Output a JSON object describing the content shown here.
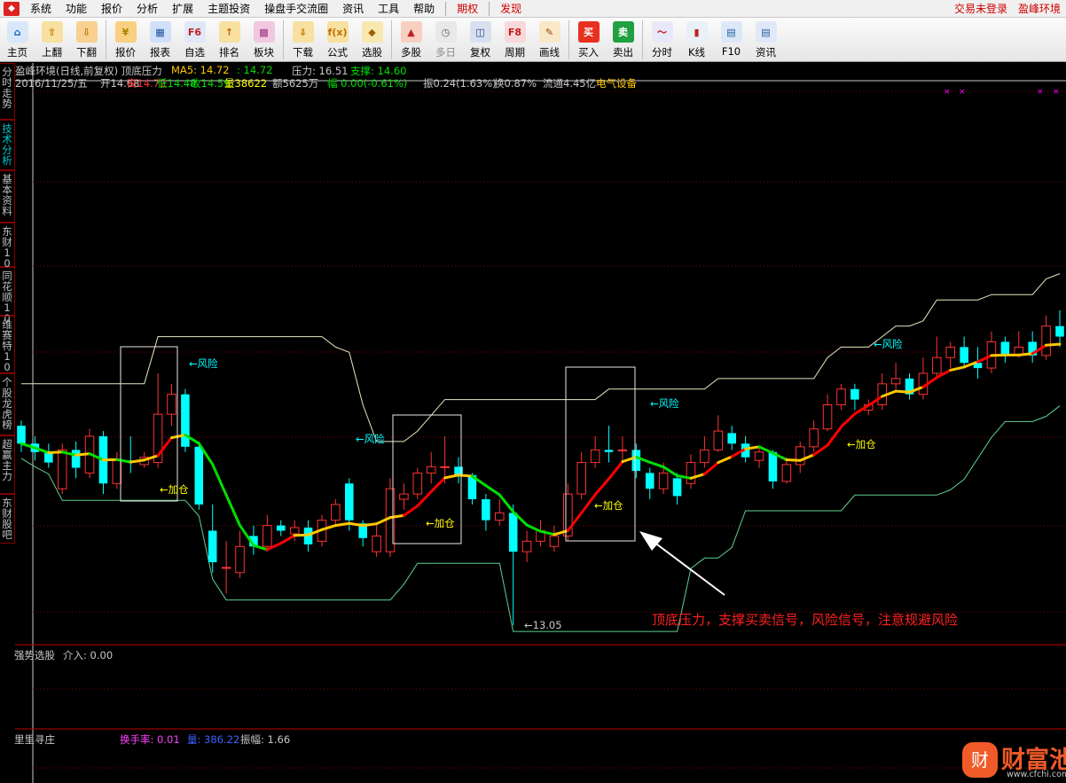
{
  "menubar": {
    "items": [
      "系统",
      "功能",
      "报价",
      "分析",
      "扩展",
      "主题投资",
      "操盘手交流圈",
      "资讯",
      "工具",
      "帮助"
    ],
    "highlight_items": [
      "期权",
      "发现"
    ],
    "login_status": "交易未登录",
    "stock_name": "盈峰环境"
  },
  "toolbar": {
    "buttons": [
      {
        "label": "主页",
        "icon": "home-icon"
      },
      {
        "label": "上翻",
        "icon": "arrow-up-icon"
      },
      {
        "label": "下翻",
        "icon": "arrow-down-icon"
      },
      {
        "label": "报价",
        "icon": "quote-icon"
      },
      {
        "label": "报表",
        "icon": "report-icon"
      },
      {
        "label": "自选",
        "icon": "f6-icon",
        "glyph": "F6"
      },
      {
        "label": "排名",
        "icon": "rank-icon"
      },
      {
        "label": "板块",
        "icon": "sector-icon"
      },
      {
        "label": "下载",
        "icon": "download-icon"
      },
      {
        "label": "公式",
        "icon": "formula-icon",
        "glyph": "f(x)"
      },
      {
        "label": "选股",
        "icon": "stock-pick-icon"
      },
      {
        "label": "多股",
        "icon": "multi-stock-icon"
      },
      {
        "label": "多日",
        "icon": "multi-day-icon",
        "dim": true
      },
      {
        "label": "复权",
        "icon": "adjust-icon"
      },
      {
        "label": "周期",
        "icon": "f8-icon",
        "glyph": "F8"
      },
      {
        "label": "画线",
        "icon": "draw-line-icon"
      },
      {
        "label": "买入",
        "icon": "buy-icon",
        "glyph": "买"
      },
      {
        "label": "卖出",
        "icon": "sell-icon",
        "glyph": "卖"
      },
      {
        "label": "分时",
        "icon": "intraday-icon"
      },
      {
        "label": "K线",
        "icon": "kline-icon"
      },
      {
        "label": "F10",
        "icon": "f10-icon"
      },
      {
        "label": "资讯",
        "icon": "news-icon"
      }
    ]
  },
  "sidetabs": [
    {
      "label": "分时走势",
      "active": false
    },
    {
      "label": "技术分析",
      "active": true
    },
    {
      "label": "基本资料",
      "active": false
    },
    {
      "label": "东财10",
      "active": false
    },
    {
      "label": "同花顺10",
      "active": false
    },
    {
      "label": "维赛特10",
      "active": false
    },
    {
      "label": "个股龙虎榜",
      "active": false
    },
    {
      "label": "超赢主力",
      "active": false
    },
    {
      "label": "东财股吧",
      "active": false
    }
  ],
  "main_header": {
    "title": "盈峰环境(日线,前复权) 顶底压力",
    "ma5_label": "MA5: 14.72",
    "ma5_value": ": 14.72",
    "pressure": "压力: 16.51",
    "support": "支撑: 14.60",
    "date": "2016/11/25/五",
    "open": "开14.68",
    "high": "高14.72",
    "low": "低14.48",
    "close": "收14.59",
    "volume": "量38622",
    "amount": "额5625万",
    "change": "幅 0.00(-0.61%)",
    "amplitude": "振0.24(1.63%)",
    "turnover": "换0.87%",
    "float_cap": "流通4.45亿",
    "industry": "电气设备"
  },
  "annotations": {
    "risk": "←风险",
    "add": "←加仓",
    "low_marker": "←13.05",
    "note": "顶底压力，支撑买卖信号，风险信号，注意规避风险"
  },
  "sub1": {
    "title": "强势选股",
    "value": "介入: 0.00"
  },
  "sub2": {
    "title": "里里寻庄",
    "turnover": "换手率: 0.01",
    "volume": "量: 386.22",
    "amplitude": "振幅: 1.66"
  },
  "watermark": {
    "brand": "财富池",
    "url": "www.cfchi.com",
    "badge_glyph": "财"
  },
  "colors": {
    "up": "#ff3232",
    "down": "#00ffff",
    "ma_up": "#ff0000",
    "ma_down": "#00e000",
    "ma_flat": "#ffc800",
    "grid": "#800000",
    "cyan_text": "#00ffff",
    "yellow_text": "#ffff00",
    "pressure_line": "#e8e8c0",
    "support_line": "#60d090"
  },
  "chart_data": {
    "type": "candlestick",
    "ma_label": "MA5",
    "low_point": 13.05,
    "candles": [
      {
        "o": 14.95,
        "c": 14.78,
        "h": 15.0,
        "l": 14.7
      },
      {
        "o": 14.78,
        "c": 14.7,
        "h": 14.85,
        "l": 14.62
      },
      {
        "o": 14.7,
        "c": 14.6,
        "h": 14.78,
        "l": 14.55
      },
      {
        "o": 14.35,
        "c": 14.72,
        "h": 14.78,
        "l": 14.3
      },
      {
        "o": 14.72,
        "c": 14.55,
        "h": 14.8,
        "l": 14.45
      },
      {
        "o": 14.5,
        "c": 14.85,
        "h": 14.92,
        "l": 14.45
      },
      {
        "o": 14.85,
        "c": 14.4,
        "h": 14.9,
        "l": 14.3
      },
      {
        "o": 14.4,
        "c": 14.62,
        "h": 14.7,
        "l": 14.35
      },
      {
        "o": 14.62,
        "c": 14.6,
        "h": 14.85,
        "l": 14.5
      },
      {
        "o": 14.58,
        "c": 14.65,
        "h": 14.7,
        "l": 14.55
      },
      {
        "o": 14.6,
        "c": 15.06,
        "h": 15.45,
        "l": 14.55
      },
      {
        "o": 15.06,
        "c": 15.25,
        "h": 15.35,
        "l": 14.95
      },
      {
        "o": 15.25,
        "c": 14.75,
        "h": 15.3,
        "l": 14.7
      },
      {
        "o": 14.75,
        "c": 14.2,
        "h": 14.8,
        "l": 14.15
      },
      {
        "o": 13.95,
        "c": 13.65,
        "h": 14.2,
        "l": 13.55
      },
      {
        "o": 13.6,
        "c": 13.6,
        "h": 13.85,
        "l": 13.35
      },
      {
        "o": 13.55,
        "c": 13.8,
        "h": 13.95,
        "l": 13.5
      },
      {
        "o": 13.9,
        "c": 13.8,
        "h": 14.0,
        "l": 13.72
      },
      {
        "o": 13.8,
        "c": 14.0,
        "h": 14.1,
        "l": 13.75
      },
      {
        "o": 14.0,
        "c": 13.95,
        "h": 14.05,
        "l": 13.9
      },
      {
        "o": 13.92,
        "c": 13.98,
        "h": 14.05,
        "l": 13.85
      },
      {
        "o": 13.98,
        "c": 13.82,
        "h": 14.05,
        "l": 13.75
      },
      {
        "o": 13.85,
        "c": 14.05,
        "h": 14.1,
        "l": 13.8
      },
      {
        "o": 14.05,
        "c": 14.2,
        "h": 14.25,
        "l": 14.0
      },
      {
        "o": 14.4,
        "c": 14.05,
        "h": 14.45,
        "l": 13.95
      },
      {
        "o": 14.02,
        "c": 13.88,
        "h": 14.05,
        "l": 13.8
      },
      {
        "o": 13.75,
        "c": 13.9,
        "h": 14.0,
        "l": 13.7
      },
      {
        "o": 13.75,
        "c": 14.35,
        "h": 14.45,
        "l": 13.7
      },
      {
        "o": 14.25,
        "c": 14.3,
        "h": 14.4,
        "l": 14.15
      },
      {
        "o": 14.3,
        "c": 14.5,
        "h": 14.55,
        "l": 14.25
      },
      {
        "o": 14.5,
        "c": 14.56,
        "h": 14.7,
        "l": 14.4
      },
      {
        "o": 14.56,
        "c": 14.56,
        "h": 14.85,
        "l": 14.4
      },
      {
        "o": 14.56,
        "c": 14.48,
        "h": 14.65,
        "l": 14.4
      },
      {
        "o": 14.48,
        "c": 14.25,
        "h": 14.5,
        "l": 14.2
      },
      {
        "o": 14.25,
        "c": 14.05,
        "h": 14.3,
        "l": 13.95
      },
      {
        "o": 14.05,
        "c": 14.12,
        "h": 14.25,
        "l": 14.0
      },
      {
        "o": 14.12,
        "c": 13.75,
        "h": 14.2,
        "l": 13.05
      },
      {
        "o": 13.75,
        "c": 13.85,
        "h": 13.95,
        "l": 13.65
      },
      {
        "o": 13.85,
        "c": 13.95,
        "h": 14.05,
        "l": 13.8
      },
      {
        "o": 13.8,
        "c": 13.9,
        "h": 14.0,
        "l": 13.75
      },
      {
        "o": 13.9,
        "c": 14.3,
        "h": 14.4,
        "l": 13.85
      },
      {
        "o": 14.3,
        "c": 14.6,
        "h": 14.7,
        "l": 14.25
      },
      {
        "o": 14.6,
        "c": 14.72,
        "h": 14.85,
        "l": 14.55
      },
      {
        "o": 14.72,
        "c": 14.7,
        "h": 14.95,
        "l": 14.6
      },
      {
        "o": 14.72,
        "c": 14.72,
        "h": 14.85,
        "l": 14.6
      },
      {
        "o": 14.72,
        "c": 14.52,
        "h": 14.78,
        "l": 14.45
      },
      {
        "o": 14.5,
        "c": 14.35,
        "h": 14.55,
        "l": 14.25
      },
      {
        "o": 14.35,
        "c": 14.5,
        "h": 14.6,
        "l": 14.3
      },
      {
        "o": 14.45,
        "c": 14.28,
        "h": 14.5,
        "l": 14.2
      },
      {
        "o": 14.4,
        "c": 14.6,
        "h": 14.68,
        "l": 14.35
      },
      {
        "o": 14.6,
        "c": 14.72,
        "h": 14.85,
        "l": 14.55
      },
      {
        "o": 14.72,
        "c": 14.9,
        "h": 15.05,
        "l": 14.7
      },
      {
        "o": 14.88,
        "c": 14.78,
        "h": 14.95,
        "l": 14.72
      },
      {
        "o": 14.78,
        "c": 14.65,
        "h": 14.85,
        "l": 14.6
      },
      {
        "o": 14.62,
        "c": 14.7,
        "h": 14.75,
        "l": 14.55
      },
      {
        "o": 14.7,
        "c": 14.42,
        "h": 14.72,
        "l": 14.35
      },
      {
        "o": 14.42,
        "c": 14.58,
        "h": 14.65,
        "l": 14.4
      },
      {
        "o": 14.58,
        "c": 14.75,
        "h": 14.8,
        "l": 14.5
      },
      {
        "o": 14.75,
        "c": 14.92,
        "h": 15.0,
        "l": 14.7
      },
      {
        "o": 14.92,
        "c": 15.15,
        "h": 15.25,
        "l": 14.9
      },
      {
        "o": 15.15,
        "c": 15.3,
        "h": 15.35,
        "l": 15.1
      },
      {
        "o": 15.3,
        "c": 15.2,
        "h": 15.35,
        "l": 15.1
      },
      {
        "o": 15.1,
        "c": 15.15,
        "h": 15.2,
        "l": 15.05
      },
      {
        "o": 15.15,
        "c": 15.35,
        "h": 15.45,
        "l": 15.1
      },
      {
        "o": 15.35,
        "c": 15.4,
        "h": 15.55,
        "l": 15.3
      },
      {
        "o": 15.4,
        "c": 15.25,
        "h": 15.45,
        "l": 15.2
      },
      {
        "o": 15.25,
        "c": 15.45,
        "h": 15.6,
        "l": 15.2
      },
      {
        "o": 15.45,
        "c": 15.6,
        "h": 15.8,
        "l": 15.4
      },
      {
        "o": 15.6,
        "c": 15.7,
        "h": 15.75,
        "l": 15.5
      },
      {
        "o": 15.7,
        "c": 15.55,
        "h": 15.8,
        "l": 15.5
      },
      {
        "o": 15.55,
        "c": 15.5,
        "h": 15.7,
        "l": 15.4
      },
      {
        "o": 15.5,
        "c": 15.75,
        "h": 15.85,
        "l": 15.45
      },
      {
        "o": 15.75,
        "c": 15.62,
        "h": 15.8,
        "l": 15.55
      },
      {
        "o": 15.62,
        "c": 15.7,
        "h": 15.85,
        "l": 15.6
      },
      {
        "o": 15.75,
        "c": 15.62,
        "h": 15.85,
        "l": 15.55
      },
      {
        "o": 15.62,
        "c": 15.9,
        "h": 16.0,
        "l": 15.58
      },
      {
        "o": 15.9,
        "c": 15.8,
        "h": 16.05,
        "l": 15.7
      }
    ]
  }
}
